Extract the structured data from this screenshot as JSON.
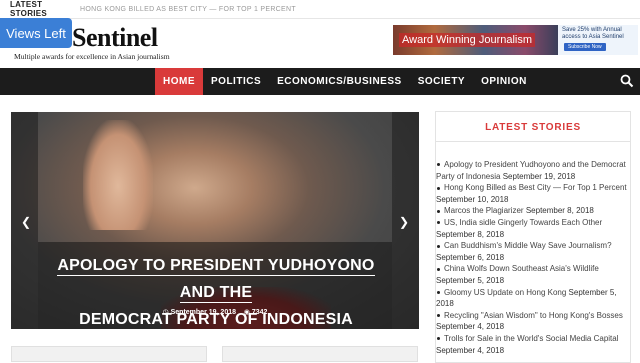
{
  "ticker": {
    "label": "LATEST STORIES",
    "text": "HONG KONG BILLED AS BEST CITY — FOR TOP 1 PERCENT"
  },
  "views_left": "Views Left",
  "logo": {
    "name": "Sentinel",
    "tagline": "Multiple awards for excellence in Asian journalism"
  },
  "ad": {
    "banner_text": "Award Winning Journalism",
    "side_text": "Save 25% with Annual access to Asia Sentinel",
    "button": "Subscribe Now"
  },
  "nav": {
    "items": [
      "HOME",
      "POLITICS",
      "ECONOMICS/BUSINESS",
      "SOCIETY",
      "OPINION"
    ],
    "search_icon": "search-icon"
  },
  "hero": {
    "title_line1": "APOLOGY TO PRESIDENT YUDHOYONO AND THE",
    "title_line2": "DEMOCRAT PARTY OF INDONESIA",
    "date": "September 19, 2018",
    "views": "7342",
    "prev_icon": "chevron-left-icon",
    "next_icon": "chevron-right-icon"
  },
  "sidebar": {
    "title": "LATEST STORIES",
    "stories": [
      {
        "title": "Apology to President Yudhoyono and the Democrat Party of Indonesia",
        "date": "September 19, 2018"
      },
      {
        "title": "Hong Kong Billed as Best City — For Top 1 Percent",
        "date": "September 10, 2018"
      },
      {
        "title": "Marcos the Plagiarizer",
        "date": "September 8, 2018"
      },
      {
        "title": "US, India sidle Gingerly Towards Each Other",
        "date": "September 8, 2018"
      },
      {
        "title": "Can Buddhism's Middle Way Save Journalism?",
        "date": "September 6, 2018"
      },
      {
        "title": "China Wolfs Down Southeast Asia's Wildlife",
        "date": "September 5, 2018"
      },
      {
        "title": "Gloomy US Update on Hong Kong",
        "date": "September 5, 2018"
      },
      {
        "title": "Recycling \"Asian Wisdom\" to Hong Kong's Bosses",
        "date": "September 4, 2018"
      },
      {
        "title": "Trolls for Sale in the World's Social Media Capital",
        "date": "September 4, 2018"
      }
    ]
  },
  "colors": {
    "accent": "#d93a3a",
    "nav_bg": "#1c1c1c",
    "views_left": "#3b7fd6"
  }
}
